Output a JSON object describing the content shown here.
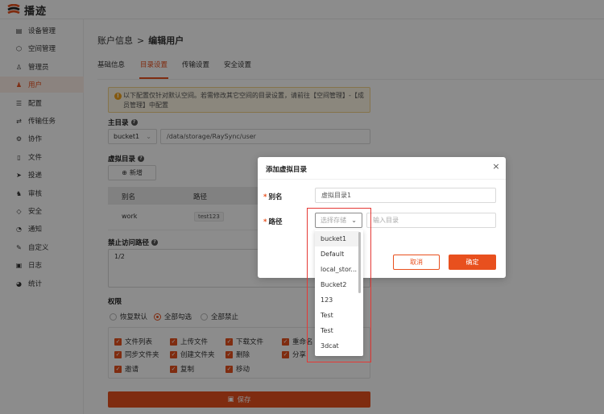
{
  "app": {
    "brand": "播迹"
  },
  "sidebar": {
    "items": [
      {
        "label": "设备管理",
        "icon": "device-icon"
      },
      {
        "label": "空间管理",
        "icon": "space-icon"
      },
      {
        "label": "管理员",
        "icon": "admin-icon"
      },
      {
        "label": "用户",
        "icon": "user-icon",
        "active": true
      },
      {
        "label": "配置",
        "icon": "config-icon"
      },
      {
        "label": "传输任务",
        "icon": "transfer-icon"
      },
      {
        "label": "协作",
        "icon": "collab-icon"
      },
      {
        "label": "文件",
        "icon": "file-icon"
      },
      {
        "label": "投递",
        "icon": "send-icon"
      },
      {
        "label": "审核",
        "icon": "audit-icon"
      },
      {
        "label": "安全",
        "icon": "security-icon"
      },
      {
        "label": "通知",
        "icon": "bell-icon"
      },
      {
        "label": "自定义",
        "icon": "custom-icon"
      },
      {
        "label": "日志",
        "icon": "log-icon"
      },
      {
        "label": "统计",
        "icon": "stats-icon"
      }
    ]
  },
  "breadcrumb": {
    "parent": "账户信息",
    "sep": ">",
    "current": "编辑用户"
  },
  "tabs": [
    {
      "label": "基础信息"
    },
    {
      "label": "目录设置",
      "active": true
    },
    {
      "label": "传输设置"
    },
    {
      "label": "安全设置"
    }
  ],
  "alert": {
    "text": "以下配置仅针对默认空间。若需修改其它空间的目录设置，请前往【空间管理】-【成员管理】中配置"
  },
  "main_dir": {
    "label": "主目录",
    "storage": "bucket1",
    "path": "/data/storage/RaySync/user"
  },
  "virtual_dir": {
    "label": "虚拟目录",
    "add_label": "新增",
    "columns": [
      "别名",
      "路径"
    ],
    "rows": [
      {
        "alias": "work",
        "path": "test123"
      }
    ]
  },
  "forbidden": {
    "label": "禁止访问路径",
    "value": "1/2"
  },
  "permissions": {
    "label": "权限",
    "radios": [
      {
        "label": "恢复默认",
        "checked": false
      },
      {
        "label": "全部勾选",
        "checked": true
      },
      {
        "label": "全部禁止",
        "checked": false
      }
    ],
    "checks": [
      "文件列表",
      "上传文件",
      "下载文件",
      "重命名",
      "同步文件夹",
      "创建文件夹",
      "删除",
      "分享",
      "邀请",
      "复制",
      "移动"
    ]
  },
  "save_label": "保存",
  "modal": {
    "title": "添加虚拟目录",
    "alias_label": "别名",
    "alias_value": "虚拟目录1",
    "path_label": "路径",
    "storage_placeholder": "选择存储",
    "dir_placeholder": "输入目录",
    "cancel_label": "取消",
    "ok_label": "确定",
    "options": [
      "bucket1",
      "Default",
      "local_stor...",
      "Bucket2",
      "123",
      "Test",
      "Test",
      "3dcat"
    ]
  },
  "colors": {
    "accent": "#e8501e",
    "highlight": "#e53935"
  }
}
